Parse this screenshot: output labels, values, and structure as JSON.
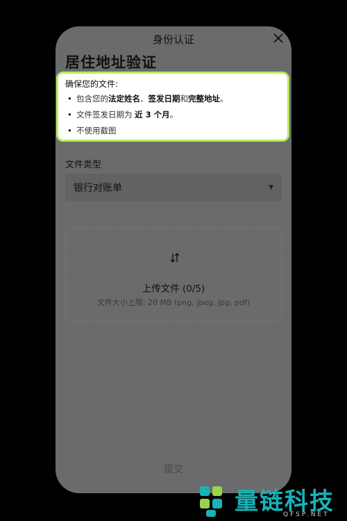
{
  "header": {
    "title": "身份认证"
  },
  "page": {
    "title": "居住地址验证"
  },
  "requirements": {
    "heading": "确保您的文件:",
    "item1": {
      "prefix": "包含您的",
      "name": "法定姓名",
      "sep1": "、",
      "date": "签发日期",
      "sep2": "和",
      "address": "完整地址",
      "suffix": "。"
    },
    "item2": {
      "prefix": "文件签发日期为 ",
      "strong": "近 3 个月",
      "suffix": "。"
    },
    "item3": {
      "text": "不使用截图"
    }
  },
  "document_type": {
    "label": "文件类型",
    "value": "银行对账单"
  },
  "upload": {
    "label": "上传文件 (0/5)",
    "hint": "文件大小上限: 20 MB (png, jpeg, jpg, pdf)"
  },
  "submit": {
    "label": "提交"
  },
  "watermark": {
    "name": "量链科技",
    "site": "QFSP.NET"
  },
  "icons": {
    "close": "close-icon",
    "upload": "upload-arrows-icon",
    "dropdown": "caret-down-icon"
  },
  "colors": {
    "highlight_border": "#b5ec5c",
    "watermark": "#17b3b9",
    "overlay": "#6b6b6d"
  }
}
